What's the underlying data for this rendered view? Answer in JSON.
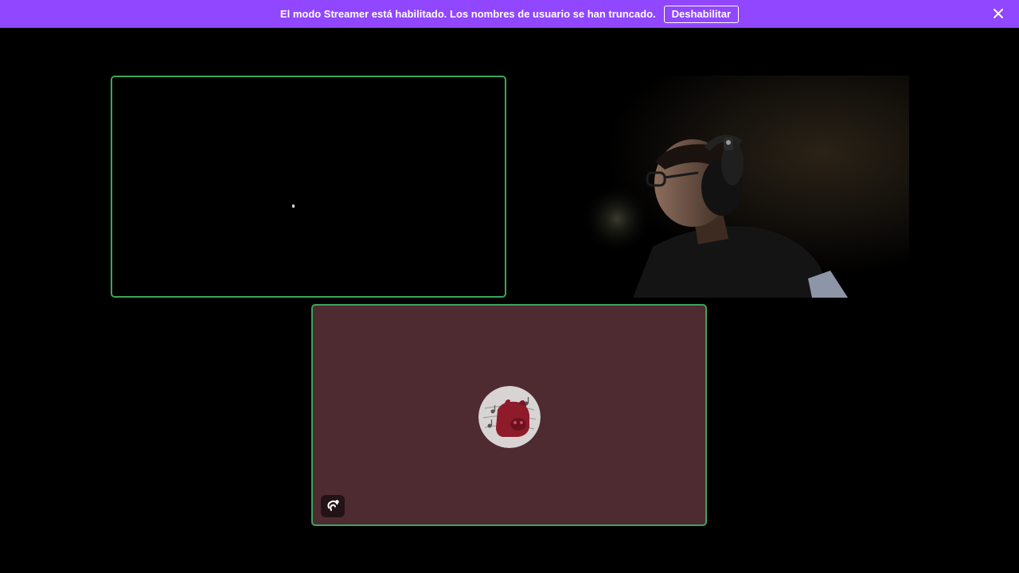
{
  "notice": {
    "text": "El modo Streamer está habilitado. Los nombres de usuario se han truncado.",
    "button_label": "Deshabilitar",
    "close_icon": "close-icon",
    "background_color": "#9146ff"
  },
  "tiles": {
    "screenshare": {
      "speaking_border_color": "#3ba55c"
    },
    "camera": {
      "content": "webcam-feed"
    },
    "avatar_tile": {
      "background_color": "#4e2a31",
      "speaking_border_color": "#3ba55c",
      "avatar_icon": "avatar-icon",
      "badge_icon": "voice-activity-icon"
    }
  }
}
